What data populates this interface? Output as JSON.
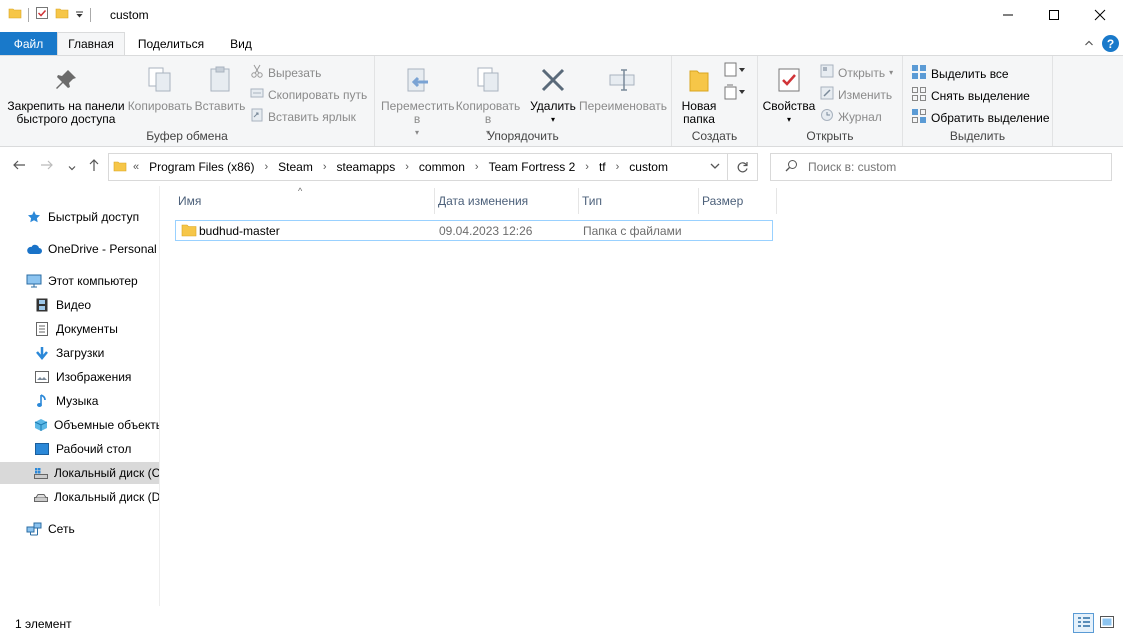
{
  "window": {
    "title": "custom",
    "controls": {
      "minimize": "—",
      "maximize": "☐",
      "close": "✕"
    }
  },
  "tabs": [
    {
      "label": "Файл"
    },
    {
      "label": "Главная"
    },
    {
      "label": "Поделиться"
    },
    {
      "label": "Вид"
    }
  ],
  "ribbon": {
    "clipboard": {
      "label": "Буфер обмена",
      "pin": "Закрепить на панели быстрого доступа",
      "copy": "Копировать",
      "paste": "Вставить",
      "cut": "Вырезать",
      "copy_path": "Скопировать путь",
      "paste_shortcut": "Вставить ярлык"
    },
    "organize": {
      "label": "Упорядочить",
      "move_to": "Переместить в",
      "copy_to": "Копировать в",
      "delete": "Удалить",
      "rename": "Переименовать"
    },
    "create": {
      "label": "Создать",
      "new_folder": "Новая папка"
    },
    "open": {
      "label": "Открыть",
      "properties": "Свойства",
      "open": "Открыть",
      "edit": "Изменить",
      "history": "Журнал"
    },
    "select": {
      "label": "Выделить",
      "select_all": "Выделить все",
      "select_none": "Снять выделение",
      "invert": "Обратить выделение"
    }
  },
  "address": {
    "overflow": "«",
    "crumbs": [
      "Program Files (x86)",
      "Steam",
      "steamapps",
      "common",
      "Team Fortress 2",
      "tf",
      "custom"
    ]
  },
  "search": {
    "placeholder": "Поиск в: custom"
  },
  "nav": {
    "quick_access": "Быстрый доступ",
    "onedrive": "OneDrive - Personal",
    "this_pc": "Этот компьютер",
    "video": "Видео",
    "documents": "Документы",
    "downloads": "Загрузки",
    "pictures": "Изображения",
    "music": "Музыка",
    "objects3d": "Объемные объекты",
    "desktop": "Рабочий стол",
    "disk_c": "Локальный диск (C:)",
    "disk_d": "Локальный диск (D:)",
    "network": "Сеть"
  },
  "columns": {
    "name": "Имя",
    "date": "Дата изменения",
    "type": "Тип",
    "size": "Размер"
  },
  "files": [
    {
      "name": "budhud-master",
      "date": "09.04.2023 12:26",
      "type": "Папка с файлами",
      "size": ""
    }
  ],
  "status": {
    "count": "1 элемент"
  },
  "colors": {
    "accent": "#1979ca",
    "folder": "#f6c648",
    "selection": "#99d1ff"
  }
}
